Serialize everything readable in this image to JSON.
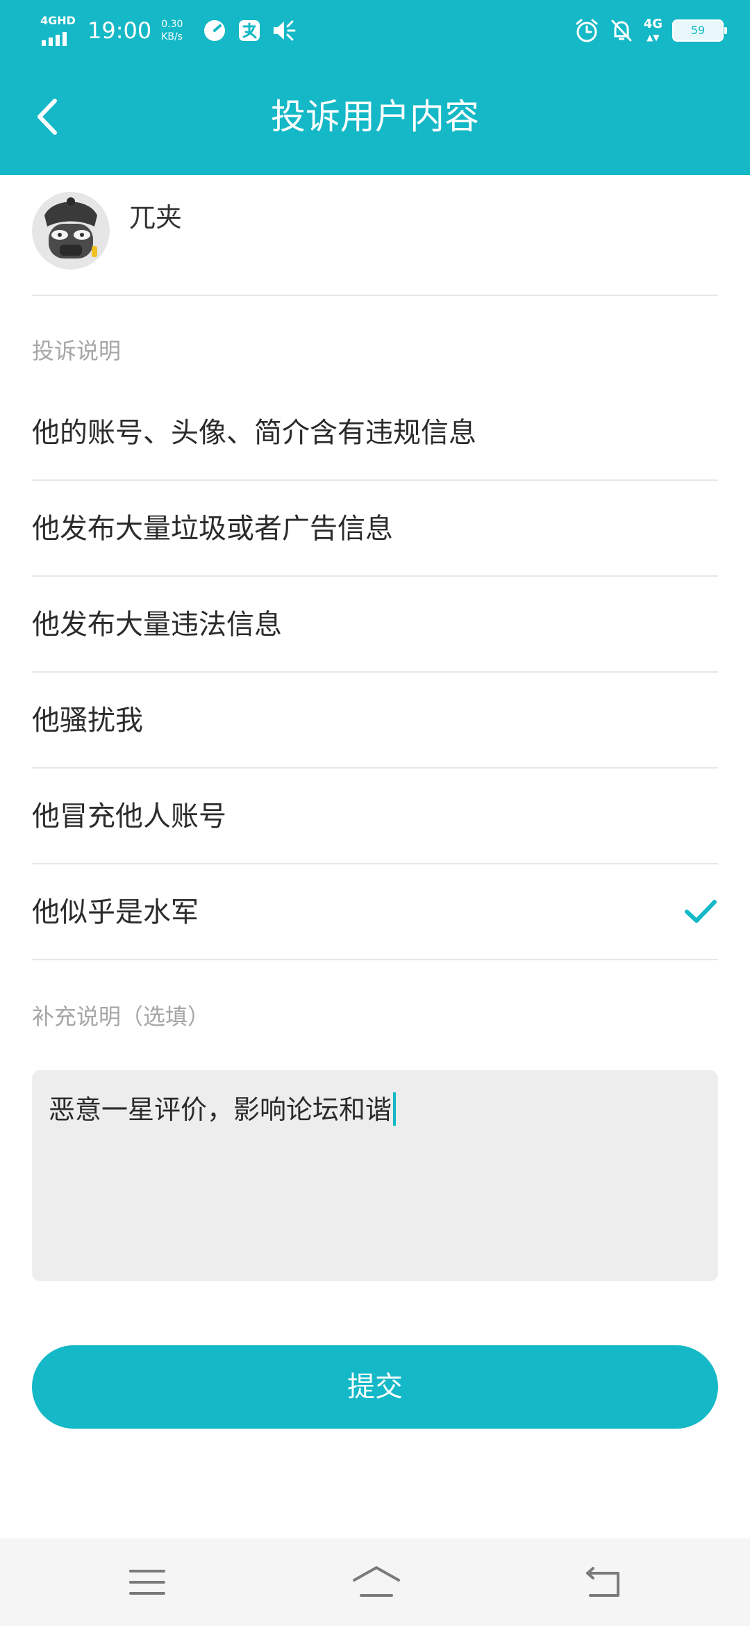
{
  "status_bar": {
    "network": "4GHD",
    "time": "19:00",
    "speed_value": "0.30",
    "speed_unit": "KB/s",
    "right_network": "4G",
    "battery": "59"
  },
  "header": {
    "title": "投诉用户内容"
  },
  "user": {
    "name": "兀夹"
  },
  "complaint": {
    "section_label": "投诉说明",
    "reasons": [
      {
        "label": "他的账号、头像、简介含有违规信息",
        "selected": false
      },
      {
        "label": "他发布大量垃圾或者广告信息",
        "selected": false
      },
      {
        "label": "他发布大量违法信息",
        "selected": false
      },
      {
        "label": "他骚扰我",
        "selected": false
      },
      {
        "label": "他冒充他人账号",
        "selected": false
      },
      {
        "label": "他似乎是水军",
        "selected": true
      }
    ]
  },
  "supplement": {
    "label": "补充说明（选填）",
    "value": "恶意一星评价，影响论坛和谐"
  },
  "submit": {
    "label": "提交"
  },
  "colors": {
    "accent": "#14b8c6",
    "muted_text": "#a6a6a6",
    "input_bg": "#ededed",
    "nav_bg": "#f5f5f5"
  },
  "icons": {
    "back": "chevron-left-icon",
    "check": "checkmark-icon",
    "nav_menu": "menu-icon",
    "nav_home": "home-icon",
    "nav_back": "return-icon"
  }
}
